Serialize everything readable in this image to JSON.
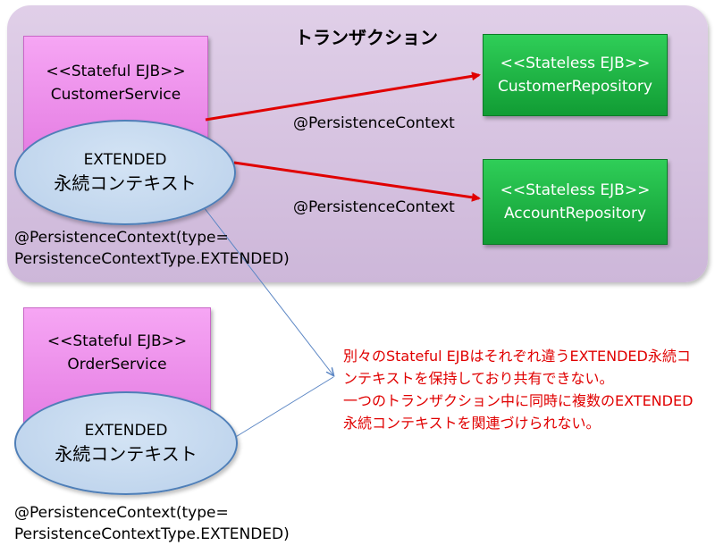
{
  "transaction": {
    "title": "トランザクション"
  },
  "customer_service": {
    "stereotype": "<<Stateful EJB>>",
    "name": "CustomerService",
    "context_line1": "EXTENDED",
    "context_line2": "永続コンテキスト",
    "annotation_line1": "@PersistenceContext(type=",
    "annotation_line2": "PersistenceContextType.EXTENDED)"
  },
  "customer_repository": {
    "stereotype": "<<Stateless EJB>>",
    "name": "CustomerRepository"
  },
  "account_repository": {
    "stereotype": "<<Stateless EJB>>",
    "name": "AccountRepository"
  },
  "arrow_labels": {
    "to_customer_repo": "@PersistenceContext",
    "to_account_repo": "@PersistenceContext"
  },
  "order_service": {
    "stereotype": "<<Stateful EJB>>",
    "name": "OrderService",
    "context_line1": "EXTENDED",
    "context_line2": "永続コンテキスト",
    "annotation_line1": "@PersistenceContext(type=",
    "annotation_line2": "PersistenceContextType.EXTENDED)"
  },
  "note": {
    "line1": "別々のStateful EJBはそれぞれ違うEXTENDED永続コ",
    "line2": "ンテキストを保持しており共有できない。",
    "line3": "一つのトランザクション中に同時に複数のEXTENDED",
    "line4": "永続コンテキストを関連づけられない。"
  },
  "colors": {
    "arrow": "#e00000",
    "connector": "#5b86c4",
    "note_text": "#e00000"
  }
}
